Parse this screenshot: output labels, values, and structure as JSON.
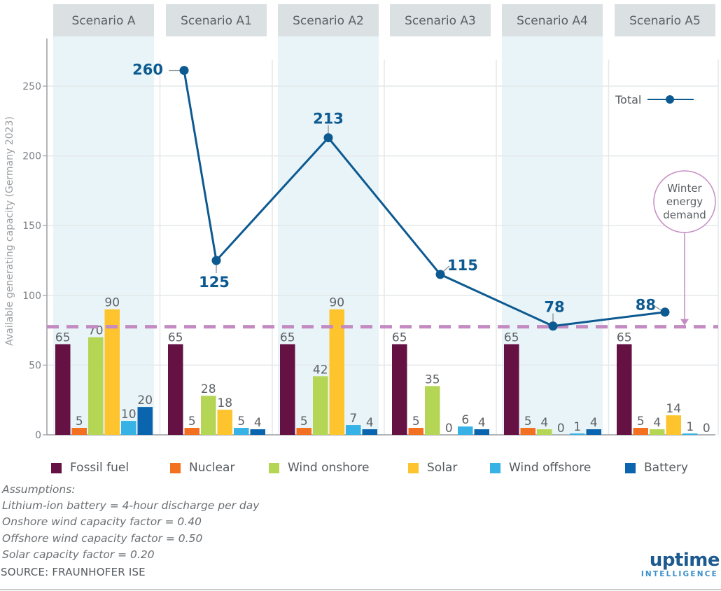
{
  "chart_data": {
    "type": "bar",
    "title": "",
    "ylabel": "Available generating capacity (Germany 2023)",
    "xlabel": "",
    "ylim": [
      0,
      280
    ],
    "yticks": [
      0,
      50,
      100,
      150,
      200,
      250
    ],
    "grid": true,
    "categories": [
      "Scenario A",
      "Scenario A1",
      "Scenario A2",
      "Scenario A3",
      "Scenario A4",
      "Scenario A5"
    ],
    "highlighted_categories": [
      "Scenario A",
      "Scenario A2",
      "Scenario A4"
    ],
    "series": [
      {
        "name": "Fossil fuel",
        "color": "#651143",
        "values": [
          65,
          65,
          65,
          65,
          65,
          65
        ]
      },
      {
        "name": "Nuclear",
        "color": "#f37021",
        "values": [
          5,
          5,
          5,
          5,
          5,
          5
        ]
      },
      {
        "name": "Wind onshore",
        "color": "#b5d655",
        "values": [
          70,
          28,
          42,
          35,
          4,
          4
        ]
      },
      {
        "name": "Solar",
        "color": "#fec42d",
        "values": [
          90,
          18,
          90,
          0,
          0,
          14
        ]
      },
      {
        "name": "Wind offshore",
        "color": "#36b2e6",
        "values": [
          10,
          5,
          7,
          6,
          1,
          1
        ]
      },
      {
        "name": "Battery",
        "color": "#0a64ae",
        "values": [
          20,
          4,
          4,
          4,
          4,
          0
        ]
      }
    ],
    "line_series": {
      "name": "Total",
      "type": "line",
      "color": "#0d5a91",
      "values": [
        260,
        125,
        213,
        115,
        78,
        88
      ],
      "labels": [
        "260",
        "125",
        "213",
        "115",
        "78",
        "88"
      ]
    },
    "reference_line": {
      "name": "Winter energy demand",
      "label_lines": [
        "Winter",
        "energy",
        "demand"
      ],
      "value": 78,
      "style": "dashed",
      "color": "#c48bc2"
    },
    "legend": {
      "placement": "bottom",
      "line_legend_placement": "top-right",
      "line_legend_label": "Total"
    }
  },
  "notes": {
    "heading": "Assumptions:",
    "lines": [
      "Lithium-ion battery = 4-hour discharge per day",
      "Onshore wind capacity factor = 0.40",
      "Offshore wind capacity factor = 0.50",
      "Solar capacity factor = 0.20"
    ]
  },
  "source": "SOURCE: FRAUNHOFER ISE",
  "branding": {
    "logo_main": "uptime",
    "logo_sub": "INTELLIGENCE"
  }
}
